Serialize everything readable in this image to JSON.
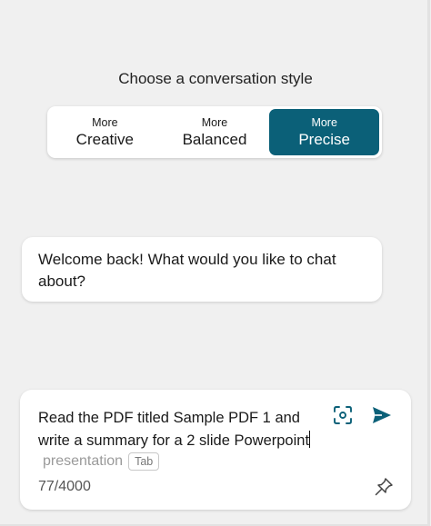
{
  "style_picker": {
    "title": "Choose a conversation style",
    "options": [
      {
        "prefix": "More",
        "label": "Creative"
      },
      {
        "prefix": "More",
        "label": "Balanced"
      },
      {
        "prefix": "More",
        "label": "Precise"
      }
    ],
    "selected_index": 2
  },
  "welcome": {
    "message": "Welcome back! What would you like to chat about?"
  },
  "composer": {
    "text_line1": "Read the PDF titled Sample PDF 1 and",
    "text_line2": "write a summary for a 2 slide Powerpoint",
    "suggestion": "presentation",
    "tab_hint": "Tab",
    "char_count": "77/4000"
  },
  "icons": {
    "scan": "visual-search-icon",
    "send": "send-icon",
    "pin": "pin-icon"
  },
  "colors": {
    "accent": "#0b6078",
    "background": "#f0f0f0",
    "card": "#ffffff"
  }
}
